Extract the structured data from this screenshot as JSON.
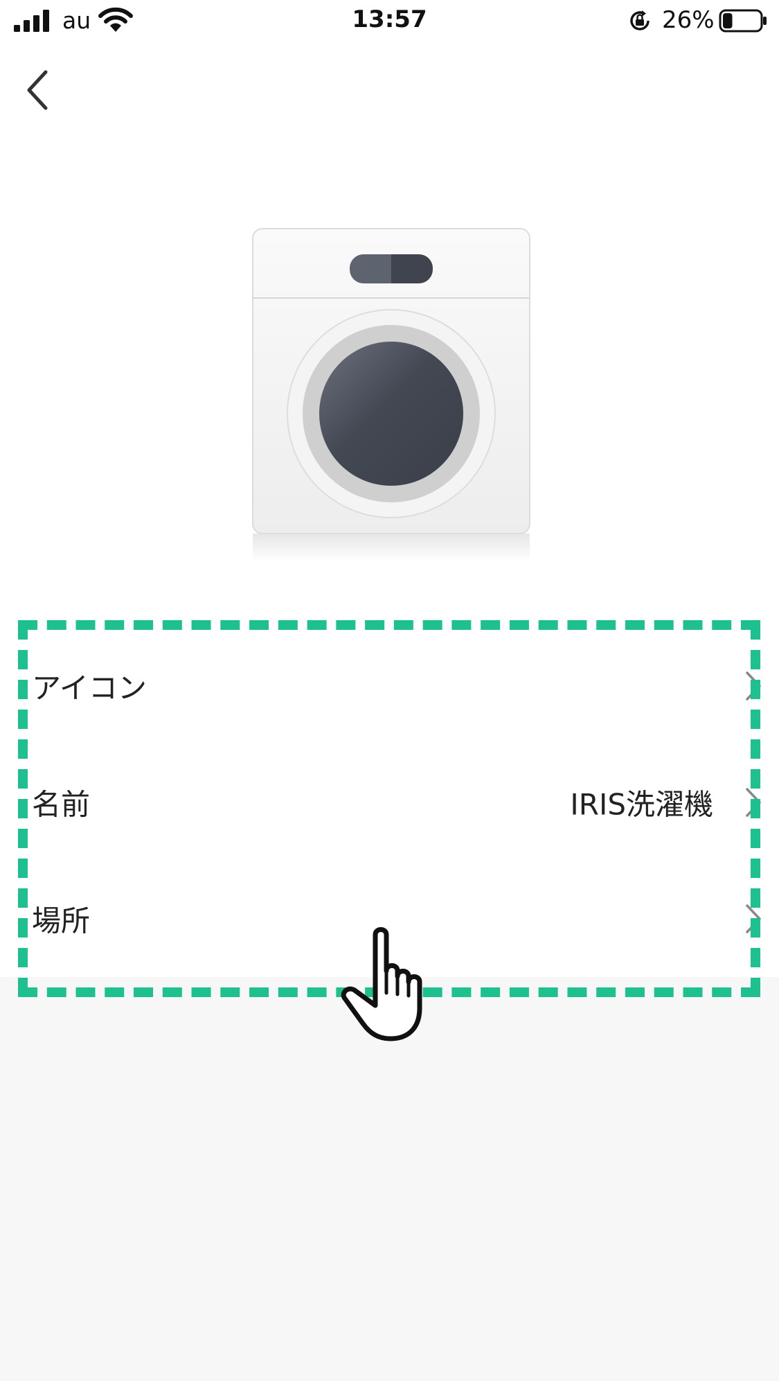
{
  "status_bar": {
    "carrier": "au",
    "time": "13:57",
    "battery_percent": "26%",
    "battery_level": 0.26
  },
  "device": {
    "image_icon": "washing-machine-icon"
  },
  "settings": {
    "rows": [
      {
        "label": "アイコン",
        "value": ""
      },
      {
        "label": "名前",
        "value": "IRIS洗濯機"
      },
      {
        "label": "場所",
        "value": ""
      }
    ]
  },
  "annotation": {
    "highlight_color": "#1fc08f",
    "pointer_icon": "pointing-hand-icon"
  }
}
